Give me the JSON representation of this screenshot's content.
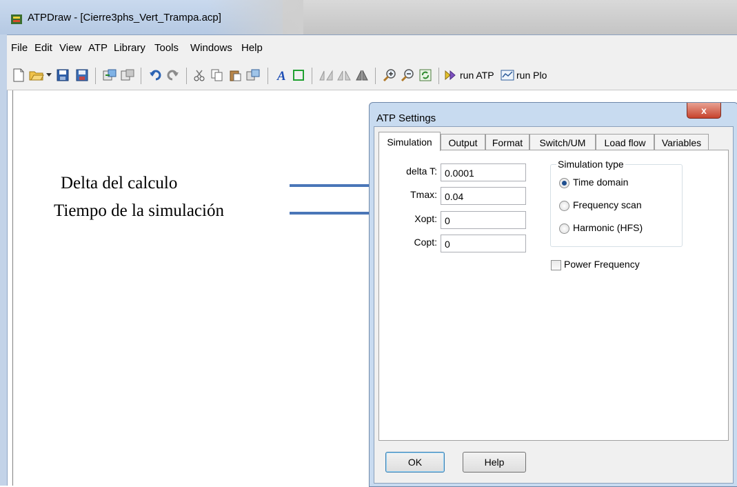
{
  "window": {
    "title": "ATPDraw - [Cierre3phs_Vert_Trampa.acp]"
  },
  "menu": [
    "File",
    "Edit",
    "View",
    "ATP",
    "Library",
    "Tools",
    "Windows",
    "Help"
  ],
  "toolbar": {
    "run_atp_label": "run ATP",
    "run_plot_label": "run Plo"
  },
  "annotations": {
    "delta_label": "Delta del calculo",
    "tiempo_label": "Tiempo de la simulación",
    "arrow_color": "#4a76b8"
  },
  "dialog": {
    "title": "ATP Settings",
    "close_label": "x",
    "tabs": [
      "Simulation",
      "Output",
      "Format",
      "Switch/UM",
      "Load flow",
      "Variables"
    ],
    "active_tab": "Simulation",
    "fields": {
      "delta_t": {
        "label": "delta T:",
        "value": "0.0001"
      },
      "tmax": {
        "label": "Tmax:",
        "value": "0.04"
      },
      "xopt": {
        "label": "Xopt:",
        "value": "0"
      },
      "copt": {
        "label": "Copt:",
        "value": "0"
      }
    },
    "simulation_type": {
      "title": "Simulation type",
      "options": [
        "Time domain",
        "Frequency scan",
        "Harmonic (HFS)"
      ],
      "selected": "Time domain"
    },
    "power_frequency": {
      "label": "Power Frequency",
      "checked": false
    },
    "buttons": {
      "ok": "OK",
      "help": "Help"
    }
  }
}
